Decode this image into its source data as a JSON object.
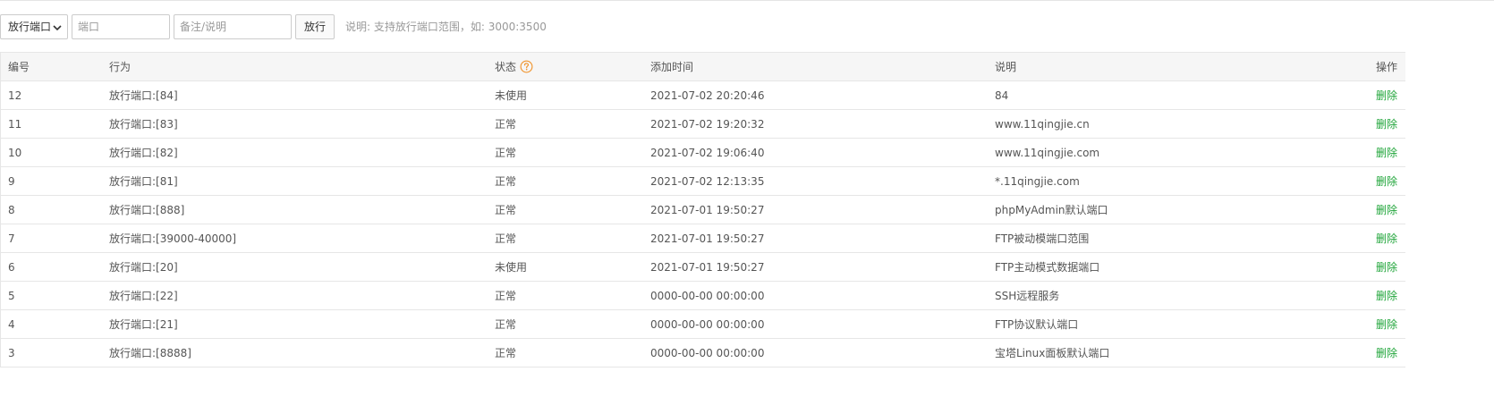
{
  "toolbar": {
    "select_value": "放行端口",
    "port_placeholder": "端口",
    "note_placeholder": "备注/说明",
    "submit_label": "放行",
    "hint": "说明: 支持放行端口范围，如: 3000:3500"
  },
  "table": {
    "headers": {
      "id": "编号",
      "action": "行为",
      "state": "状态",
      "time": "添加时间",
      "desc": "说明",
      "op": "操作"
    },
    "rows": [
      {
        "id": "12",
        "action": "放行端口:[84]",
        "state": "未使用",
        "time": "2021-07-02 20:20:46",
        "desc": "84",
        "op": "删除"
      },
      {
        "id": "11",
        "action": "放行端口:[83]",
        "state": "正常",
        "time": "2021-07-02 19:20:32",
        "desc": "www.11qingjie.cn",
        "op": "删除"
      },
      {
        "id": "10",
        "action": "放行端口:[82]",
        "state": "正常",
        "time": "2021-07-02 19:06:40",
        "desc": "www.11qingjie.com",
        "op": "删除"
      },
      {
        "id": "9",
        "action": "放行端口:[81]",
        "state": "正常",
        "time": "2021-07-02 12:13:35",
        "desc": "*.11qingjie.com",
        "op": "删除"
      },
      {
        "id": "8",
        "action": "放行端口:[888]",
        "state": "正常",
        "time": "2021-07-01 19:50:27",
        "desc": "phpMyAdmin默认端口",
        "op": "删除"
      },
      {
        "id": "7",
        "action": "放行端口:[39000-40000]",
        "state": "正常",
        "time": "2021-07-01 19:50:27",
        "desc": "FTP被动模端口范围",
        "op": "删除"
      },
      {
        "id": "6",
        "action": "放行端口:[20]",
        "state": "未使用",
        "time": "2021-07-01 19:50:27",
        "desc": "FTP主动模式数据端口",
        "op": "删除"
      },
      {
        "id": "5",
        "action": "放行端口:[22]",
        "state": "正常",
        "time": "0000-00-00 00:00:00",
        "desc": "SSH远程服务",
        "op": "删除"
      },
      {
        "id": "4",
        "action": "放行端口:[21]",
        "state": "正常",
        "time": "0000-00-00 00:00:00",
        "desc": "FTP协议默认端口",
        "op": "删除"
      },
      {
        "id": "3",
        "action": "放行端口:[8888]",
        "state": "正常",
        "time": "0000-00-00 00:00:00",
        "desc": "宝塔Linux面板默认端口",
        "op": "删除"
      }
    ]
  },
  "colors": {
    "accent_green": "#20a53a",
    "help_icon_orange": "#f0932b"
  },
  "icons": {
    "state_help": "question-circle-icon",
    "select_caret": "chevron-down-icon"
  }
}
